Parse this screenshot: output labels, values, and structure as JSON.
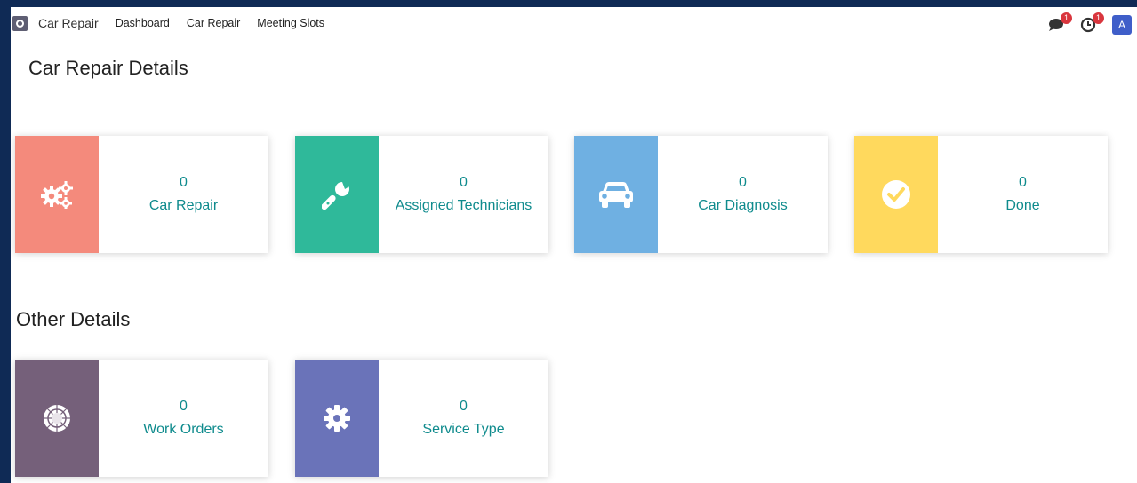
{
  "topbar": {
    "app_name": "Car Repair",
    "nav": [
      "Dashboard",
      "Car Repair",
      "Meeting Slots"
    ],
    "messages_badge": "1",
    "activities_badge": "1",
    "avatar_letter": "A"
  },
  "sections": {
    "car_repair_details": "Car Repair Details",
    "other_details": "Other Details"
  },
  "cards": [
    {
      "count": "0",
      "label": "Car Repair",
      "color": "#f48a7c",
      "icon": "gears-icon"
    },
    {
      "count": "0",
      "label": "Assigned Technicians",
      "color": "#2fb99a",
      "icon": "wrench-icon"
    },
    {
      "count": "0",
      "label": "Car Diagnosis",
      "color": "#6fb0e2",
      "icon": "car-icon"
    },
    {
      "count": "0",
      "label": "Done",
      "color": "#ffd95d",
      "icon": "check-circle-icon"
    },
    {
      "count": "0",
      "label": "Work Orders",
      "color": "#75607a",
      "icon": "empire-icon"
    },
    {
      "count": "0",
      "label": "Service Type",
      "color": "#6a73b9",
      "icon": "cog-icon"
    }
  ]
}
